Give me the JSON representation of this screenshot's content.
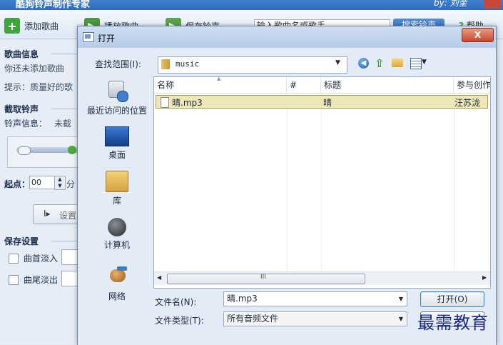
{
  "app": {
    "title": "酷狗铃声制作专家",
    "author": "by: 刘奎",
    "toolbar": {
      "add_song": "添加歌曲",
      "play_song": "播放歌曲",
      "save_ringtone": "保存铃声",
      "search_placeholder": "输入歌曲名或歌手",
      "search_button": "搜索铃声",
      "help": "帮助"
    },
    "left": {
      "song_info_title": "歌曲信息",
      "no_song": "你还未添加歌曲",
      "tip": "提示：质量好的歌",
      "clip_title": "截取铃声",
      "ring_info": "铃声信息：",
      "ring_info_value": "未截",
      "start_label": "起点：",
      "start_value": "00",
      "minute_label": "分",
      "set_button": "设置",
      "save_settings_title": "保存设置",
      "fade_in": "曲首淡入",
      "fade_out": "曲尾淡出"
    }
  },
  "dialog": {
    "title": "打开",
    "close": "X",
    "look_in_label": "查找范围(I):",
    "look_in_value": "music",
    "places": [
      {
        "label": "最近访问的位置"
      },
      {
        "label": "桌面"
      },
      {
        "label": "库"
      },
      {
        "label": "计算机"
      },
      {
        "label": "网络"
      }
    ],
    "columns": {
      "name": "名称",
      "number": "#",
      "title": "标题",
      "artist": "参与创作"
    },
    "files": [
      {
        "name": "晴.mp3",
        "title": "晴",
        "artist": "汪苏泷"
      }
    ],
    "scroll_grip": "III",
    "filename_label": "文件名(N):",
    "filename_value": "晴.mp3",
    "filetype_label": "文件类型(T):",
    "filetype_value": "所有音频文件",
    "open_button": "打开(O)"
  },
  "watermark": "最需教育",
  "colors": {
    "accent": "#2f6cc0",
    "selection": "#eee8b8",
    "watermark": "#1b2a8a"
  }
}
